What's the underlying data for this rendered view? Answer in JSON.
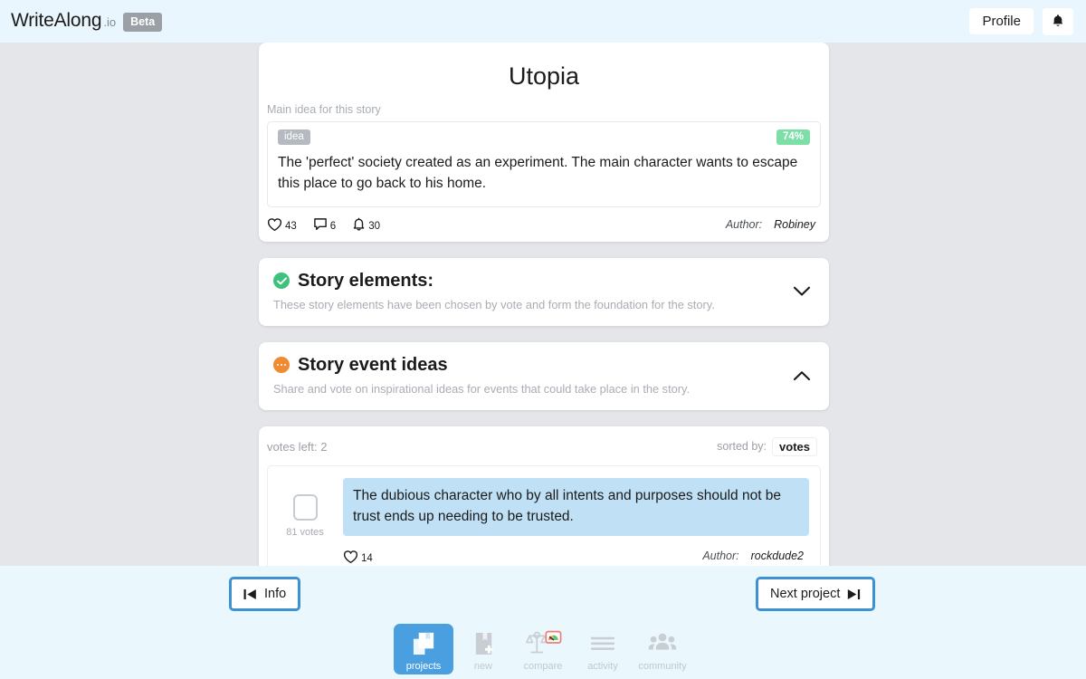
{
  "topbar": {
    "brand_name": "WriteAlong",
    "brand_tld": ".io",
    "beta_badge": "Beta",
    "profile_label": "Profile",
    "bell_icon": "bell-icon"
  },
  "story": {
    "title": "Utopia",
    "idea_field_label": "Main idea for this story",
    "idea_tag": "idea",
    "idea_percent": "74%",
    "idea_text": "The 'perfect' society created as an experiment. The main character wants to escape this place to go back to his home.",
    "likes": "43",
    "comments": "6",
    "notifications": "30",
    "author_label": "Author:",
    "author_name": "Robiney"
  },
  "sections": {
    "elements": {
      "title": "Story elements:",
      "subtitle": "These story elements have been chosen by vote and form the foundation for the story.",
      "status_icon": "check-circle-icon",
      "chevron": "chevron-down-icon"
    },
    "events": {
      "title": "Story event ideas",
      "subtitle": "Share and vote on inspirational ideas for events that could take place in the story.",
      "status_icon": "dots-circle-icon",
      "chevron": "chevron-up-icon",
      "votes_left": "votes left: 2",
      "sorted_by_label": "sorted by:",
      "sorted_by_value": "votes",
      "items": [
        {
          "text": "The dubious character who by all intents and purposes should not be trust ends up needing to be trusted.",
          "vote_count": "81 votes",
          "likes": "14",
          "author_label": "Author:",
          "author_name": "rockdude2"
        }
      ]
    }
  },
  "footer": {
    "info_button": "Info",
    "next_button": "Next project",
    "tabs": [
      {
        "label": "projects",
        "icon": "book-icon",
        "active": true
      },
      {
        "label": "new",
        "icon": "book-plus-icon",
        "active": false
      },
      {
        "label": "compare",
        "icon": "scales-gauge-icon",
        "active": false
      },
      {
        "label": "activity",
        "icon": "lines-icon",
        "active": false
      },
      {
        "label": "community",
        "icon": "people-icon",
        "active": false
      }
    ]
  },
  "colors": {
    "accent_blue": "#4a9fe0",
    "badge_green": "#7ddfa8",
    "status_green": "#3ec17c",
    "status_orange": "#ef8b32",
    "highlight_blue": "#bfe0f5",
    "page_bg": "#e5e6ea",
    "footer_bg": "#eaf7fd"
  }
}
